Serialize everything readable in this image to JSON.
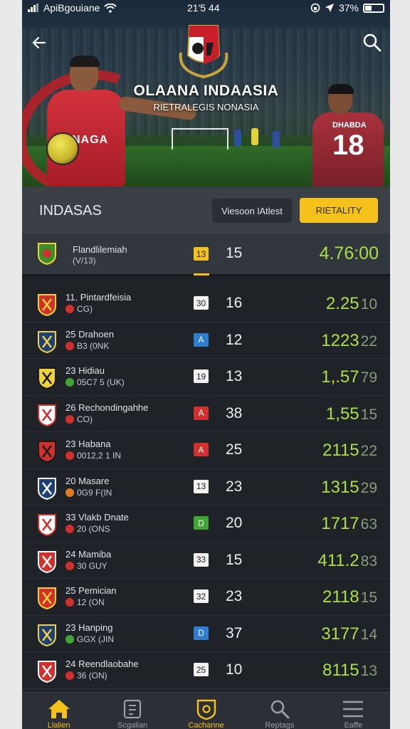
{
  "status_bar": {
    "carrier": "ApiBgouiane",
    "time": "21'5 44",
    "battery": "37%",
    "battery_level": 0.37
  },
  "hero": {
    "title": "OLAANA INDAASIA",
    "subtitle": "RIETRALEGIS NONASIA",
    "player1_jersey": "NAGA",
    "player2_name": "DHABDA",
    "player2_number": "18"
  },
  "header": {
    "title": "INDASAS",
    "secondary_button": "Viesoon lAtlest",
    "primary_button": "RIETALITY"
  },
  "featured": {
    "name": "Flandlilemiah",
    "meta": "(V/13)",
    "badge": "13",
    "badge_color": "yellow",
    "number": "15",
    "score": "4.76:00"
  },
  "rows": [
    {
      "name": "11. Pintardfeisia",
      "meta": "CG)",
      "dot": "#d0312d",
      "badge": "30",
      "badge_color": "white",
      "number": "16",
      "score": "2.25",
      "small": "10"
    },
    {
      "name": "25  Drahoen",
      "meta": "B3 (0NK",
      "dot": "#d0312d",
      "badge": "A",
      "badge_color": "blue",
      "number": "12",
      "score": "1223",
      "small": "22"
    },
    {
      "name": "23  Hidiau",
      "meta": "05C7 5 (UK)",
      "dot": "#3fa535",
      "badge": "19",
      "badge_color": "white",
      "number": "13",
      "score": "1,.57",
      "small": "79"
    },
    {
      "name": "26  Rechondingahhe",
      "meta": "CO)",
      "dot": "#d0312d",
      "badge": "A",
      "badge_color": "red",
      "number": "38",
      "score": "1,55",
      "small": "15"
    },
    {
      "name": "23  Habana",
      "meta": "0012,2 1 IN",
      "dot": "#d0312d",
      "badge": "A",
      "badge_color": "red",
      "number": "25",
      "score": "2115",
      "small": "22"
    },
    {
      "name": "20  Masare",
      "meta": "0G9 F(IN",
      "dot": "#e07a1f",
      "badge": "13",
      "badge_color": "white",
      "number": "23",
      "score": "1315",
      "small": "29"
    },
    {
      "name": "33  Vlakb Dnate",
      "meta": "20 (ONS",
      "dot": "#d0312d",
      "badge": "D",
      "badge_color": "green",
      "number": "20",
      "score": "1717",
      "small": "63"
    },
    {
      "name": "24  Mamiba",
      "meta": "30 GUY",
      "dot": "#d0312d",
      "badge": "33",
      "badge_color": "white",
      "number": "15",
      "score": "411.2",
      "small": "83"
    },
    {
      "name": "25  Pemician",
      "meta": "12 (ON",
      "dot": "#d0312d",
      "badge": "32",
      "badge_color": "white",
      "number": "23",
      "score": "2118",
      "small": "15"
    },
    {
      "name": "23  Hanping",
      "meta": "GGX (JIN",
      "dot": "#3fa535",
      "badge": "D",
      "badge_color": "blue",
      "number": "37",
      "score": "3177",
      "small": "14"
    },
    {
      "name": "24  Reendlaobahe",
      "meta": "36 (ON)",
      "dot": "#d0312d",
      "badge": "25",
      "badge_color": "white",
      "number": "10",
      "score": "8115",
      "small": "13"
    }
  ],
  "nav": [
    {
      "label": "Llalien",
      "icon": "home-icon",
      "active": true
    },
    {
      "label": "Scgalian",
      "icon": "document-icon",
      "active": false
    },
    {
      "label": "Cachanne",
      "icon": "badge-icon",
      "active": true
    },
    {
      "label": "Reptags",
      "icon": "search-icon",
      "active": false
    },
    {
      "label": "Eaffe",
      "icon": "menu-icon",
      "active": false
    }
  ],
  "colors": {
    "accent": "#f4c21b",
    "score": "#a9e04a",
    "background": "#1f2227"
  }
}
